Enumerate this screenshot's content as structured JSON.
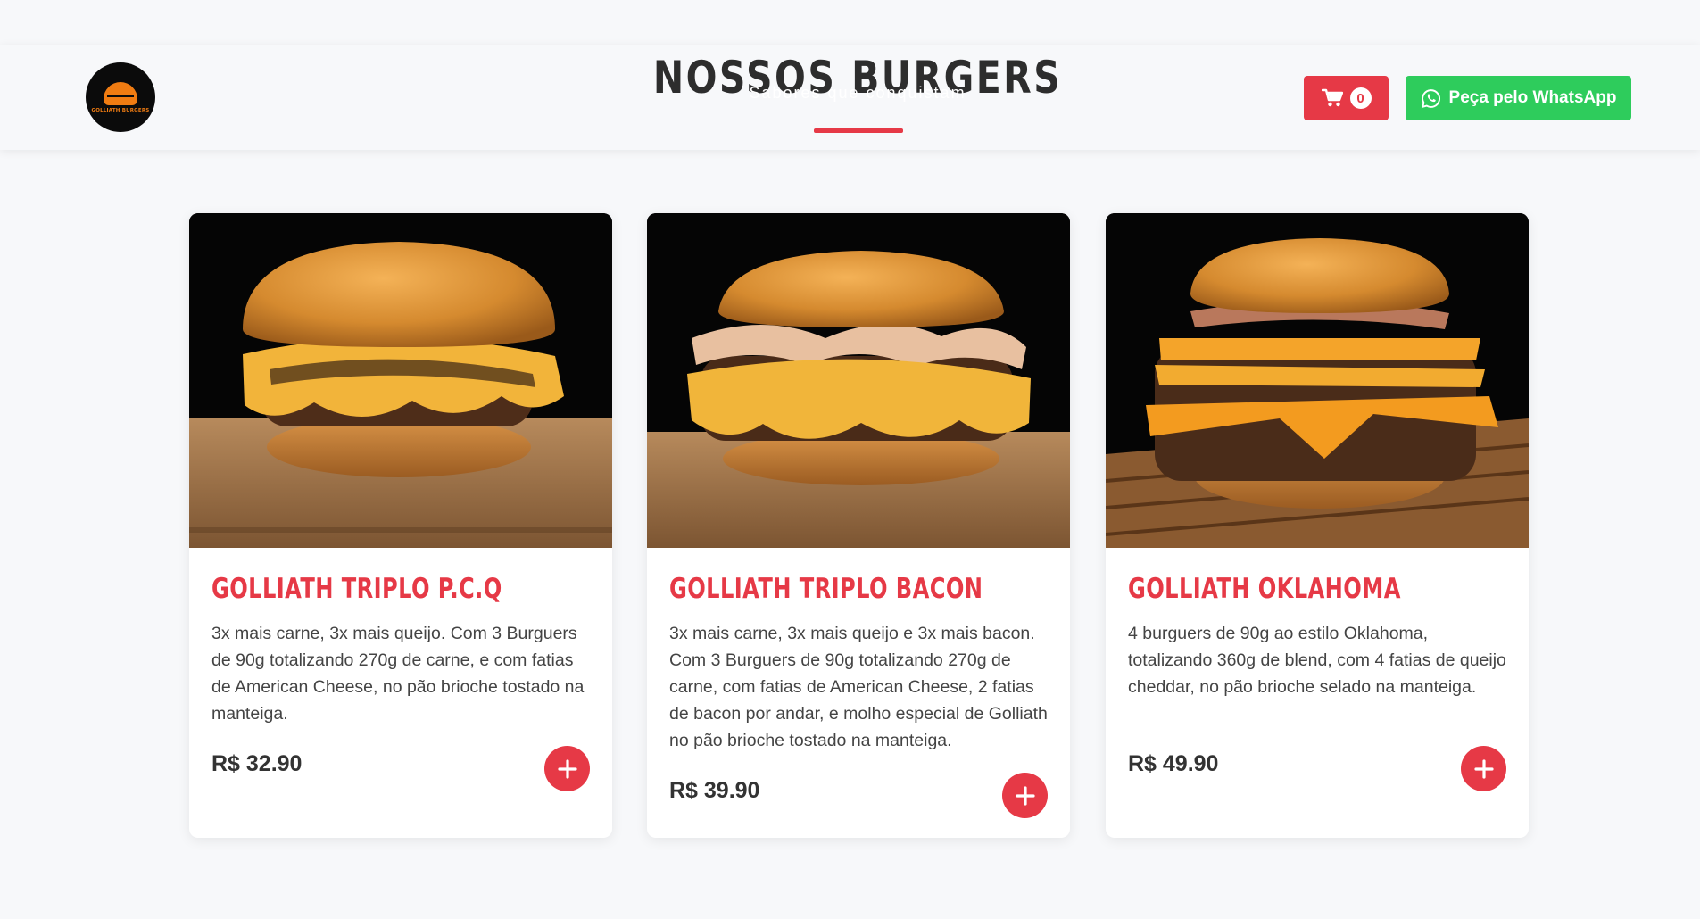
{
  "header": {
    "logo_text": "GOLLIATH BURGERS",
    "section_title": "NOSSOS BURGERS",
    "section_subtitle": "Sabores que conquistam",
    "cart": {
      "icon": "shopping-cart-icon",
      "count": "0"
    },
    "whatsapp": {
      "icon": "whatsapp-icon",
      "label": "Peça pelo WhatsApp"
    }
  },
  "colors": {
    "accent": "#e63946",
    "whatsapp": "#2ecc5c",
    "page_background": "#f7f8fa",
    "title_text": "#2d2d2d"
  },
  "products": [
    {
      "name": "GOLLIATH TRIPLO P.C.Q",
      "description": "3x mais carne, 3x mais queijo. Com 3 Burguers de 90g totalizando 270g de carne, e com fatias de American Cheese, no pão brioche tostado na manteiga.",
      "price": "R$ 32.90",
      "add_icon": "plus-icon"
    },
    {
      "name": "GOLLIATH TRIPLO BACON",
      "description": "3x mais carne, 3x mais queijo e 3x mais bacon. Com 3 Burguers de 90g totalizando 270g de carne, com fatias de American Cheese, 2 fatias de bacon por andar, e molho especial de Golliath no pão brioche tostado na manteiga.",
      "price": "R$ 39.90",
      "add_icon": "plus-icon"
    },
    {
      "name": "GOLLIATH OKLAHOMA",
      "description": "4 burguers de 90g ao estilo Oklahoma, totalizando 360g de blend, com 4 fatias de queijo cheddar, no pão brioche selado na manteiga.",
      "price": "R$ 49.90",
      "add_icon": "plus-icon"
    }
  ]
}
